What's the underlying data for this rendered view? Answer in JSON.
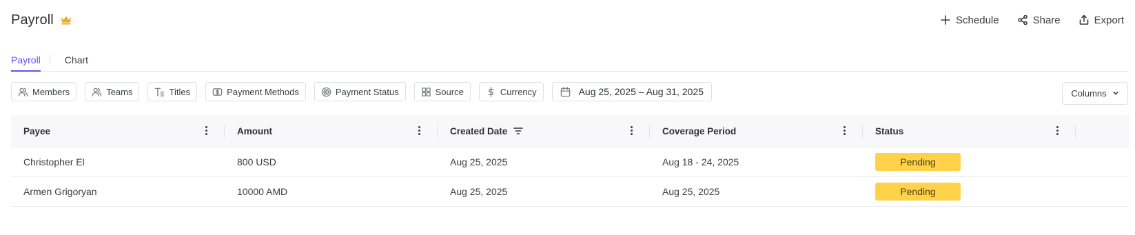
{
  "page": {
    "title": "Payroll"
  },
  "header_actions": [
    {
      "label": "Schedule",
      "icon": "plus-icon"
    },
    {
      "label": "Share",
      "icon": "share-icon"
    },
    {
      "label": "Export",
      "icon": "export-icon"
    }
  ],
  "tabs": [
    {
      "label": "Payroll",
      "active": true
    },
    {
      "label": "Chart",
      "active": false
    }
  ],
  "filters": {
    "members": "Members",
    "teams": "Teams",
    "titles": "Titles",
    "payment_methods": "Payment Methods",
    "payment_status": "Payment Status",
    "source": "Source",
    "currency": "Currency",
    "date_range": "Aug 25, 2025 – Aug 31, 2025",
    "columns": "Columns"
  },
  "table": {
    "columns": [
      "Payee",
      "Amount",
      "Created Date",
      "Coverage Period",
      "Status"
    ],
    "rows": [
      {
        "payee": "Christopher El",
        "amount": "800 USD",
        "created": "Aug 25, 2025",
        "coverage": "Aug 18 - 24, 2025",
        "status": "Pending"
      },
      {
        "payee": "Armen Grigoryan",
        "amount": "10000 AMD",
        "created": "Aug 25, 2025",
        "coverage": "Aug 25, 2025",
        "status": "Pending"
      }
    ]
  },
  "colors": {
    "accent": "#6a4df0",
    "status_pending": "#ffd24a",
    "crown": "#f5a623"
  }
}
